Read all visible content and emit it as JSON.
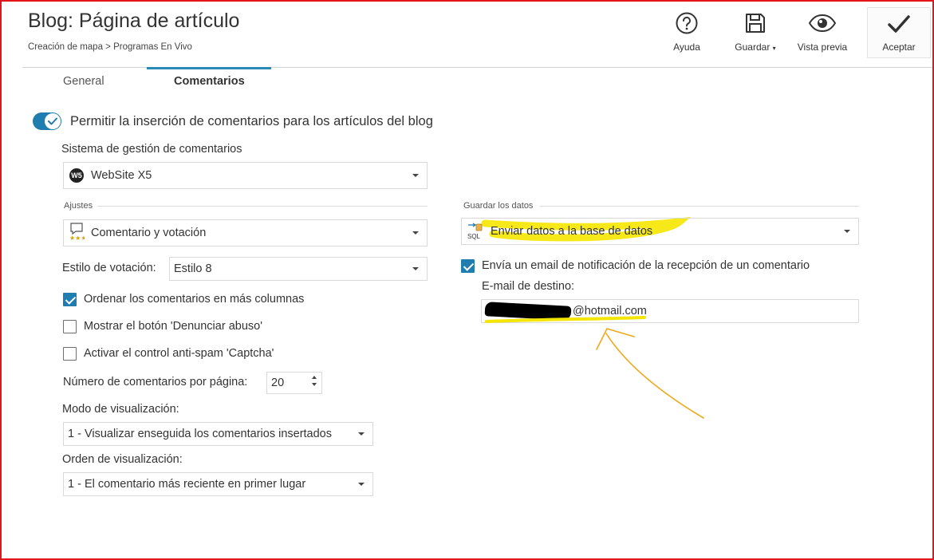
{
  "header": {
    "title": "Blog: Página de artículo",
    "breadcrumb": "Creación de mapa > Programas En Vivo"
  },
  "toolbar": {
    "help_label": "Ayuda",
    "save_label": "Guardar",
    "preview_label": "Vista previa",
    "accept_label": "Aceptar"
  },
  "tabs": {
    "general": "General",
    "comments": "Comentarios"
  },
  "main": {
    "allow_comments_label": "Permitir la inserción de comentarios para los artículos del blog",
    "allow_comments_on": true,
    "system_label": "Sistema de gestión de comentarios",
    "system_value": "WebSite X5",
    "settings_header": "Ajustes",
    "settings_value": "Comentario y votación",
    "vote_style_label": "Estilo de votación:",
    "vote_style_value": "Estilo 8",
    "order_columns_label": "Ordenar los comentarios en más columnas",
    "order_columns_checked": true,
    "report_abuse_label": "Mostrar el botón 'Denunciar abuso'",
    "report_abuse_checked": false,
    "captcha_label": "Activar el control anti-spam 'Captcha'",
    "captcha_checked": false,
    "per_page_label": "Número de comentarios por página:",
    "per_page_value": "20",
    "display_mode_label": "Modo de visualización:",
    "display_mode_value": "1 - Visualizar enseguida los comentarios insertados",
    "display_order_label": "Orden de visualización:",
    "display_order_value": "1 - El comentario más reciente en primer lugar"
  },
  "data_panel": {
    "save_data_header": "Guardar los datos",
    "save_data_value": "Enviar datos a la base de datos",
    "sql_icon_text": "SQL",
    "notify_label": "Envía un email de notificación de la recepción de un comentario",
    "notify_checked": true,
    "email_label": "E-mail de destino:",
    "email_value": "@hotmail.com"
  },
  "colors": {
    "accent": "#1f7db0",
    "highlight": "#f5e600",
    "annotation_arrow": "#f0a81c",
    "redaction": "#000000",
    "frame": "#e3141b"
  }
}
